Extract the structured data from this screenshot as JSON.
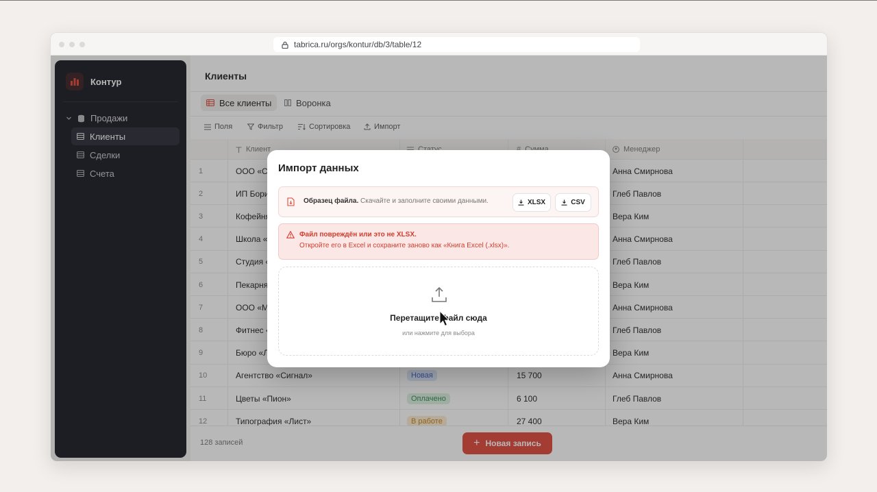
{
  "browser": {
    "url": "tabrica.ru/orgs/kontur/db/3/table/12"
  },
  "sidebar": {
    "brand": "Контур",
    "group": "Продажи",
    "items": [
      {
        "label": "Клиенты",
        "active": true
      },
      {
        "label": "Сделки",
        "active": false
      },
      {
        "label": "Счета",
        "active": false
      }
    ]
  },
  "page": {
    "title": "Клиенты"
  },
  "tabs": [
    {
      "label": "Все клиенты",
      "active": true
    },
    {
      "label": "Воронка",
      "active": false
    }
  ],
  "toolbar": {
    "fields": "Поля",
    "filter": "Фильтр",
    "sort": "Сортировка",
    "import": "Импорт"
  },
  "table": {
    "columns": [
      "Клиент",
      "Статус",
      "Сумма",
      "Менеджер"
    ],
    "rows": [
      {
        "n": "1",
        "client": "ООО «Се",
        "status": "",
        "sum": "",
        "manager": "Анна Смирнова"
      },
      {
        "n": "2",
        "client": "ИП Бори",
        "status": "",
        "sum": "",
        "manager": "Глеб Павлов"
      },
      {
        "n": "3",
        "client": "Кофейня",
        "status": "",
        "sum": "",
        "manager": "Вера Ким"
      },
      {
        "n": "4",
        "client": "Школа «.",
        "status": "",
        "sum": "",
        "manager": "Анна Смирнова"
      },
      {
        "n": "5",
        "client": "Студия «",
        "status": "",
        "sum": "",
        "manager": "Глеб Павлов"
      },
      {
        "n": "6",
        "client": "Пекарня",
        "status": "",
        "sum": "",
        "manager": "Вера Ким"
      },
      {
        "n": "7",
        "client": "ООО «Ма",
        "status": "",
        "sum": "",
        "manager": "Анна Смирнова"
      },
      {
        "n": "8",
        "client": "Фитнес «",
        "status": "",
        "sum": "",
        "manager": "Глеб Павлов"
      },
      {
        "n": "9",
        "client": "Бюро «Л",
        "status": "",
        "sum": "",
        "manager": "Вера Ким"
      },
      {
        "n": "10",
        "client": "Агентство «Сигнал»",
        "status": "Новая",
        "sum": "15 700",
        "manager": "Анна Смирнова"
      },
      {
        "n": "11",
        "client": "Цветы «Пион»",
        "status": "Оплачено",
        "sum": "6 100",
        "manager": "Глеб Павлов"
      },
      {
        "n": "12",
        "client": "Типография «Лист»",
        "status": "В работе",
        "sum": "27 400",
        "manager": "Вера Ким"
      }
    ]
  },
  "footer": {
    "count": "128 записей",
    "new_button": "Новая запись"
  },
  "modal": {
    "title": "Импорт данных",
    "sample_bold": "Образец файла.",
    "sample_text": "Скачайте и заполните своими данными.",
    "btn_xlsx": "XLSX",
    "btn_csv": "CSV",
    "error_title": "Файл повреждён или это не XLSX.",
    "error_text": "Откройте его в Excel и сохраните заново как «Книга Excel (.xlsx)».",
    "drop_title": "Перетащите файл сюда",
    "drop_hint": "или нажмите для выбора"
  },
  "colors": {
    "accent": "#e0473a",
    "sidebar": "#191923",
    "error_bg": "#fbe8e6",
    "error_text": "#d23b2d"
  }
}
